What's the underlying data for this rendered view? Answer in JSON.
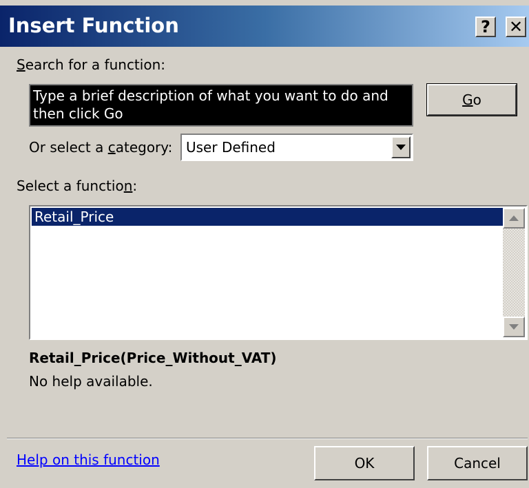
{
  "window": {
    "title": "Insert Function",
    "help_button": "?",
    "close_button": "✕"
  },
  "search": {
    "label_prefix": "",
    "label_accel": "S",
    "label_rest": "earch for a function:",
    "value": "Type a brief description of what you want to do and then click Go",
    "go_accel": "G",
    "go_rest": "o"
  },
  "category": {
    "label_prefix": "Or select a ",
    "label_accel": "c",
    "label_rest": "ategory:",
    "selected": "User Defined"
  },
  "functions": {
    "label_prefix": "Select a functio",
    "label_accel": "n",
    "label_rest": ":",
    "items": [
      "Retail_Price"
    ],
    "selected_index": 0
  },
  "details": {
    "signature": "Retail_Price(Price_Without_VAT)",
    "description": "No help available."
  },
  "footer": {
    "help_link": "Help on this function",
    "ok_label": "OK",
    "cancel_label": "Cancel"
  }
}
